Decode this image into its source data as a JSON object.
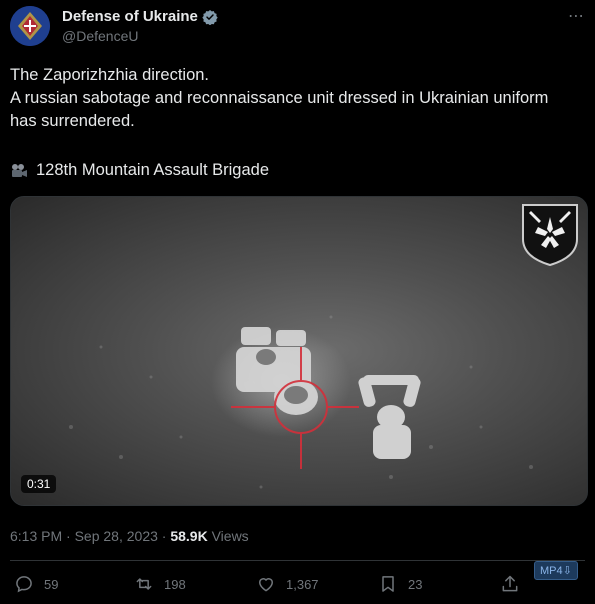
{
  "author": {
    "display_name": "Defense of Ukraine",
    "handle": "@DefenceU",
    "verified": true
  },
  "more_icon": "⋯",
  "tweet": {
    "lines": [
      "The Zaporizhzhia direction.",
      "A russian sabotage and reconnaissance unit dressed in Ukrainian uniform",
      "has surrendered."
    ],
    "brigade": "128th Mountain Assault Brigade"
  },
  "media": {
    "duration": "0:31"
  },
  "meta": {
    "time": "6:13 PM",
    "separator": "·",
    "date": "Sep 28, 2023",
    "views_count": "58.9K",
    "views_label": "Views"
  },
  "actions": {
    "replies": "59",
    "retweets": "198",
    "likes": "1,367",
    "bookmarks": "23"
  },
  "mp4_badge": "MP4⇩",
  "colors": {
    "background": "#000000",
    "text": "#e7e9ea",
    "muted": "#71767b",
    "verified": "#829aab",
    "reticle": "#d32f3a"
  }
}
